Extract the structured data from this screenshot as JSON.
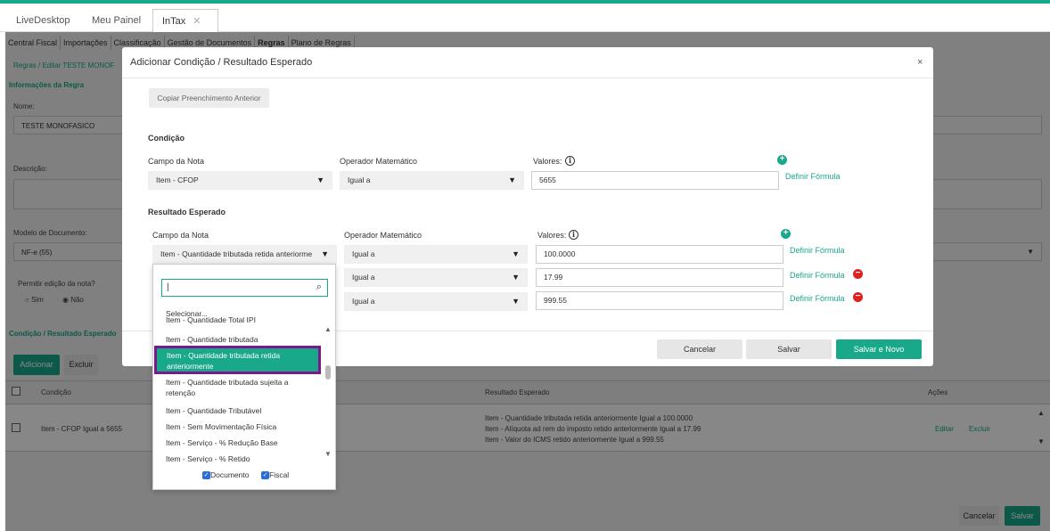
{
  "tabs": [
    "LiveDesktop",
    "Meu Painel",
    "InTax"
  ],
  "menu": [
    "Central Fiscal",
    "Importações",
    "Classificação",
    "Gestão de Documentos",
    "Regras",
    "Plano de Regras"
  ],
  "bg": {
    "breadcrumb": "Regras / Editar TESTE MONOF",
    "section_info": "Informações da Regra",
    "nome_label": "Nome:",
    "nome_value": "TESTE MONOFASICO",
    "descricao_label": "Descrição:",
    "modelo_label": "Modelo de Documento:",
    "modelo_value": "NF-e (55)",
    "permitir_label": "Permitir edição da nota?",
    "sim": "Sim",
    "nao": "Não",
    "section_cond": "Condição / Resultado Esperado",
    "adicionar": "Adicionar",
    "excluir": "Excluir",
    "table": {
      "col_condicao": "Condição",
      "col_resultado": "Resultado Esperado",
      "col_acoes": "Ações",
      "row_condicao": "Item - CFOP Igual a 5655",
      "row_resultado": [
        "Item - Quantidade tributada retida anteriormente Igual a 100.0000",
        "Item - Alíquota ad rem do imposto retido anteriormente Igual a 17.99",
        "Item - Valor do ICMS retido anteriormente Igual a 999.55"
      ],
      "editar": "Editar",
      "excluir": "Excluir"
    },
    "cancelar": "Cancelar",
    "salvar": "Salvar"
  },
  "modal": {
    "title": "Adicionar Condição / Resultado Esperado",
    "close": "×",
    "copiar": "Copiar Preenchimento Anterior",
    "condicao": {
      "heading": "Condição",
      "campo_label": "Campo da Nota",
      "operador_label": "Operador Matemático",
      "valores_label": "Valores:",
      "campo_value": "Item - CFOP",
      "operador_value": "Igual a",
      "valor": "5655",
      "definir": "Definir Fórmula"
    },
    "resultado": {
      "heading": "Resultado Esperado",
      "campo_label": "Campo da Nota",
      "operador_label": "Operador Matemático",
      "valores_label": "Valores:",
      "campo_value": "Item - Quantidade tributada retida anteriorme",
      "rows": [
        {
          "operador": "Igual a",
          "valor": "100.0000",
          "definir": "Definir Fórmula"
        },
        {
          "operador": "Igual a",
          "valor": "17.99",
          "definir": "Definir Fórmula"
        },
        {
          "operador": "Igual a",
          "valor": "999.55",
          "definir": "Definir Fórmula"
        }
      ]
    },
    "buttons": {
      "cancelar": "Cancelar",
      "salvar": "Salvar",
      "salvar_novo": "Salvar e Novo"
    }
  },
  "dropdown": {
    "search_value": "|",
    "items": [
      "Selecionar...",
      "Item - Quantidade Total IPI",
      "Item - Quantidade tributada",
      "Item - Quantidade tributada retida anteriormente",
      "Item - Quantidade tributada sujeita a retenção",
      "Item - Quantidade Tributável",
      "Item - Sem Movimentação Física",
      "Item - Serviço - % Redução Base",
      "Item - Serviço - % Retido"
    ],
    "check_documento": "Documento",
    "check_fiscal": "Fiscal"
  },
  "colors": {
    "accent": "#1aa88a",
    "highlight_border": "#7a1a8a",
    "danger": "#e02020"
  }
}
